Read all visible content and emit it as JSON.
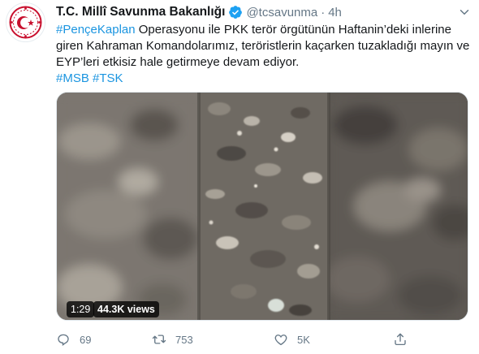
{
  "account": {
    "display_name": "T.C. Millî Savunma Bakanlığı",
    "handle": "@tcsavunma",
    "separator": "·",
    "time": "4h",
    "avatar_icon": "msb-emblem-icon",
    "brand_red": "#c8102e"
  },
  "tweet": {
    "line1_hashtag": "#PençeKaplan",
    "line1_rest": " Operasyonu ile PKK terör örgütünün Haftanin’deki inlerine",
    "line2": "giren Kahraman Komandolarımız, teröristlerin kaçarken tuzakladığı mayın ve",
    "line3": "EYP’leri etkisiz hale getirmeye devam ediyor.",
    "hashtag_msb": "#MSB",
    "hashtag_tsk": "#TSK"
  },
  "media": {
    "duration": "1:29",
    "views": "44.3K views"
  },
  "actions": {
    "reply_count": "69",
    "retweet_count": "753",
    "like_count": "5K",
    "share_icon": "share-icon"
  },
  "colors": {
    "link": "#1b95e0",
    "text": "#14171a",
    "muted": "#657786",
    "verified": "#1da1f2"
  }
}
